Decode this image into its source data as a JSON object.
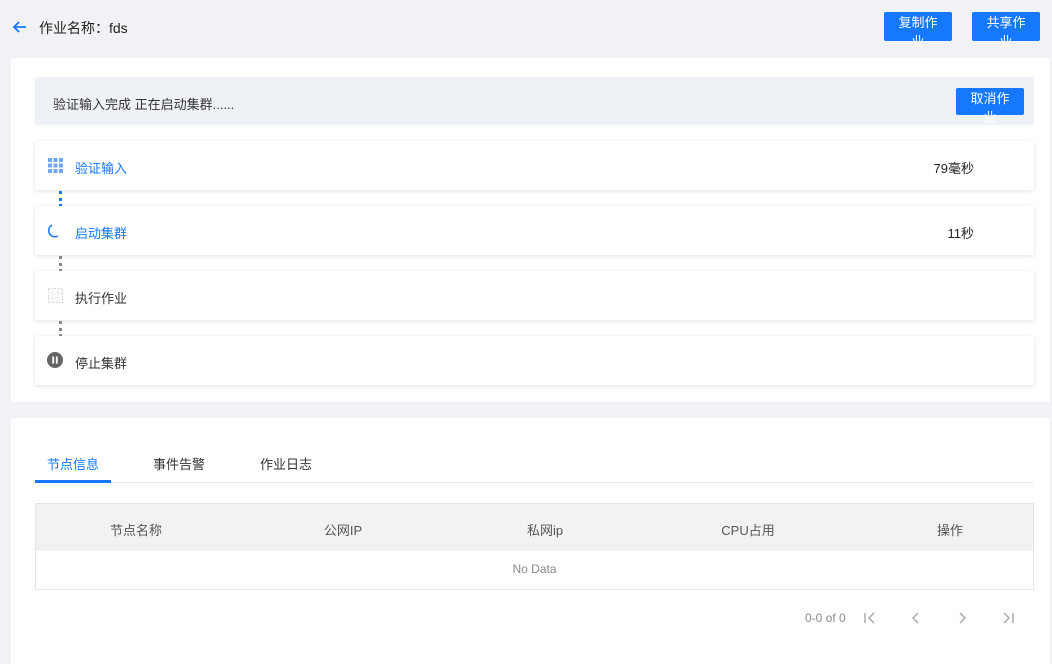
{
  "header": {
    "title": "作业名称：fds",
    "copy_label": "复制作业",
    "share_label": "共享作业"
  },
  "status": {
    "text": "验证输入完成 正在启动集群......",
    "cancel_label": "取消作业"
  },
  "steps": [
    {
      "label": "验证输入",
      "time": "79毫秒",
      "state": "done",
      "icon": "grid-icon"
    },
    {
      "label": "启动集群",
      "time": "11秒",
      "state": "running",
      "icon": "spinner-icon"
    },
    {
      "label": "执行作业",
      "time": "",
      "state": "pending",
      "icon": "grid-outline-icon"
    },
    {
      "label": "停止集群",
      "time": "",
      "state": "paused",
      "icon": "pause-icon"
    }
  ],
  "tabs": [
    {
      "label": "节点信息",
      "active": true
    },
    {
      "label": "事件告警",
      "active": false
    },
    {
      "label": "作业日志",
      "active": false
    }
  ],
  "table": {
    "columns": [
      "节点名称",
      "公网IP",
      "私网ip",
      "CPU占用",
      "操作"
    ],
    "empty_text": "No Data"
  },
  "pagination": {
    "summary": "0-0 of 0"
  },
  "colors": {
    "accent": "#1677ff",
    "background": "#f0f2f5",
    "status_bar": "#eef2f7"
  }
}
